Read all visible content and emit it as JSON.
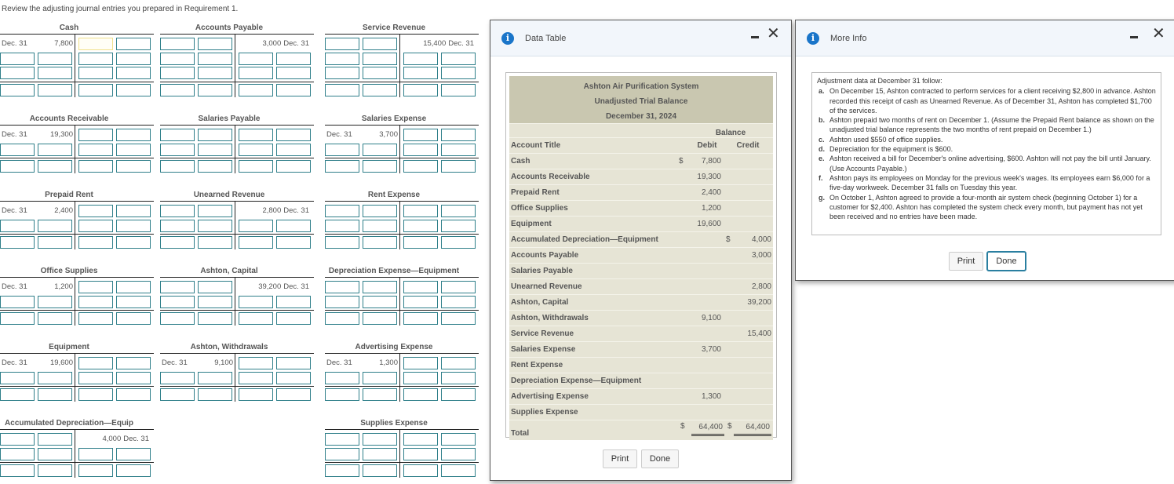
{
  "instruction": "Review the adjusting journal entries you prepared in Requirement 1.",
  "t_accounts": [
    {
      "name": "Cash",
      "debit_date": "Dec. 31",
      "debit_value": "7,800",
      "credit_date": "",
      "credit_value": ""
    },
    {
      "name": "Accounts Payable",
      "debit_date": "",
      "debit_value": "",
      "credit_date": "Dec. 31",
      "credit_value": "3,000"
    },
    {
      "name": "Service Revenue",
      "debit_date": "",
      "debit_value": "",
      "credit_date": "Dec. 31",
      "credit_value": "15,400"
    },
    {
      "name": "Accounts Receivable",
      "debit_date": "Dec. 31",
      "debit_value": "19,300",
      "credit_date": "",
      "credit_value": ""
    },
    {
      "name": "Salaries Payable",
      "debit_date": "",
      "debit_value": "",
      "credit_date": "",
      "credit_value": ""
    },
    {
      "name": "Salaries Expense",
      "debit_date": "Dec. 31",
      "debit_value": "3,700",
      "credit_date": "",
      "credit_value": ""
    },
    {
      "name": "Prepaid Rent",
      "debit_date": "Dec. 31",
      "debit_value": "2,400",
      "credit_date": "",
      "credit_value": ""
    },
    {
      "name": "Unearned Revenue",
      "debit_date": "",
      "debit_value": "",
      "credit_date": "Dec. 31",
      "credit_value": "2,800"
    },
    {
      "name": "Rent Expense",
      "debit_date": "",
      "debit_value": "",
      "credit_date": "",
      "credit_value": ""
    },
    {
      "name": "Office Supplies",
      "debit_date": "Dec. 31",
      "debit_value": "1,200",
      "credit_date": "",
      "credit_value": ""
    },
    {
      "name": "Ashton, Capital",
      "debit_date": "",
      "debit_value": "",
      "credit_date": "Dec. 31",
      "credit_value": "39,200"
    },
    {
      "name": "Depreciation Expense—Equipment",
      "debit_date": "",
      "debit_value": "",
      "credit_date": "",
      "credit_value": ""
    },
    {
      "name": "Equipment",
      "debit_date": "Dec. 31",
      "debit_value": "19,600",
      "credit_date": "",
      "credit_value": ""
    },
    {
      "name": "Ashton, Withdrawals",
      "debit_date": "Dec. 31",
      "debit_value": "9,100",
      "credit_date": "",
      "credit_value": ""
    },
    {
      "name": "Advertising Expense",
      "debit_date": "Dec. 31",
      "debit_value": "1,300",
      "credit_date": "",
      "credit_value": ""
    },
    {
      "name": "Accumulated Depreciation—Equip",
      "debit_date": "",
      "debit_value": "",
      "credit_date": "Dec. 31",
      "credit_value": "4,000"
    },
    {
      "name": "Supplies Expense",
      "debit_date": "",
      "debit_value": "",
      "credit_date": "",
      "credit_value": ""
    }
  ],
  "data_table": {
    "title": "Data Table",
    "company": "Ashton Air Purification System",
    "report": "Unadjusted Trial Balance",
    "date": "December 31, 2024",
    "balance_label": "Balance",
    "col_account": "Account Title",
    "col_debit": "Debit",
    "col_credit": "Credit",
    "rows": [
      {
        "account": "Cash",
        "debit_sign": "$",
        "debit": "7,800",
        "credit_sign": "",
        "credit": ""
      },
      {
        "account": "Accounts Receivable",
        "debit_sign": "",
        "debit": "19,300",
        "credit_sign": "",
        "credit": ""
      },
      {
        "account": "Prepaid Rent",
        "debit_sign": "",
        "debit": "2,400",
        "credit_sign": "",
        "credit": ""
      },
      {
        "account": "Office Supplies",
        "debit_sign": "",
        "debit": "1,200",
        "credit_sign": "",
        "credit": ""
      },
      {
        "account": "Equipment",
        "debit_sign": "",
        "debit": "19,600",
        "credit_sign": "",
        "credit": ""
      },
      {
        "account": "Accumulated Depreciation—Equipment",
        "debit_sign": "",
        "debit": "",
        "credit_sign": "$",
        "credit": "4,000"
      },
      {
        "account": "Accounts Payable",
        "debit_sign": "",
        "debit": "",
        "credit_sign": "",
        "credit": "3,000"
      },
      {
        "account": "Salaries Payable",
        "debit_sign": "",
        "debit": "",
        "credit_sign": "",
        "credit": ""
      },
      {
        "account": "Unearned Revenue",
        "debit_sign": "",
        "debit": "",
        "credit_sign": "",
        "credit": "2,800"
      },
      {
        "account": "Ashton, Capital",
        "debit_sign": "",
        "debit": "",
        "credit_sign": "",
        "credit": "39,200"
      },
      {
        "account": "Ashton, Withdrawals",
        "debit_sign": "",
        "debit": "9,100",
        "credit_sign": "",
        "credit": ""
      },
      {
        "account": "Service Revenue",
        "debit_sign": "",
        "debit": "",
        "credit_sign": "",
        "credit": "15,400"
      },
      {
        "account": "Salaries Expense",
        "debit_sign": "",
        "debit": "3,700",
        "credit_sign": "",
        "credit": ""
      },
      {
        "account": "Rent Expense",
        "debit_sign": "",
        "debit": "",
        "credit_sign": "",
        "credit": ""
      },
      {
        "account": "Depreciation Expense—Equipment",
        "debit_sign": "",
        "debit": "",
        "credit_sign": "",
        "credit": ""
      },
      {
        "account": "Advertising Expense",
        "debit_sign": "",
        "debit": "1,300",
        "credit_sign": "",
        "credit": ""
      },
      {
        "account": "Supplies Expense",
        "debit_sign": "",
        "debit": "",
        "credit_sign": "",
        "credit": ""
      }
    ],
    "total": {
      "account": "Total",
      "debit_sign": "$",
      "debit": "64,400",
      "credit_sign": "$",
      "credit": "64,400"
    },
    "print_label": "Print",
    "done_label": "Done"
  },
  "more_info": {
    "title": "More Info",
    "intro": "Adjustment data at December 31 follow:",
    "items": [
      {
        "label": "a.",
        "text": "On December 15, Ashton contracted to perform services for a client receiving $2,800 in advance. Ashton recorded this receipt of cash as Unearned Revenue. As of December 31, Ashton has completed $1,700 of the services."
      },
      {
        "label": "b.",
        "text": "Ashton prepaid two months of rent on December 1. (Assume the Prepaid Rent balance as shown on the unadjusted trial balance represents the two months of rent prepaid on December 1.)"
      },
      {
        "label": "c.",
        "text": "Ashton used $550 of office supplies."
      },
      {
        "label": "d.",
        "text": "Depreciation for the equipment is $600."
      },
      {
        "label": "e.",
        "text": "Ashton received a bill for December's online advertising, $600. Ashton will not pay the bill until January. (Use Accounts Payable.)"
      },
      {
        "label": "f.",
        "text": "Ashton pays its employees on Monday for the previous week's wages. Its employees earn $6,000 for a five-day workweek. December 31 falls on Tuesday this year."
      },
      {
        "label": "g.",
        "text": "On October 1, Ashton agreed to provide a four-month air system check (beginning October 1) for a customer for $2,400. Ashton has completed the system check every month, but payment has not yet been received and no entries have been made."
      }
    ],
    "print_label": "Print",
    "done_label": "Done"
  },
  "colors": {
    "input_border": "#2f7f8a",
    "info_icon": "#1a75c9",
    "table_header_bg": "#c9c7b0",
    "table_row_bg": "#e6e4d5",
    "focus_border": "#2a7fa0"
  }
}
